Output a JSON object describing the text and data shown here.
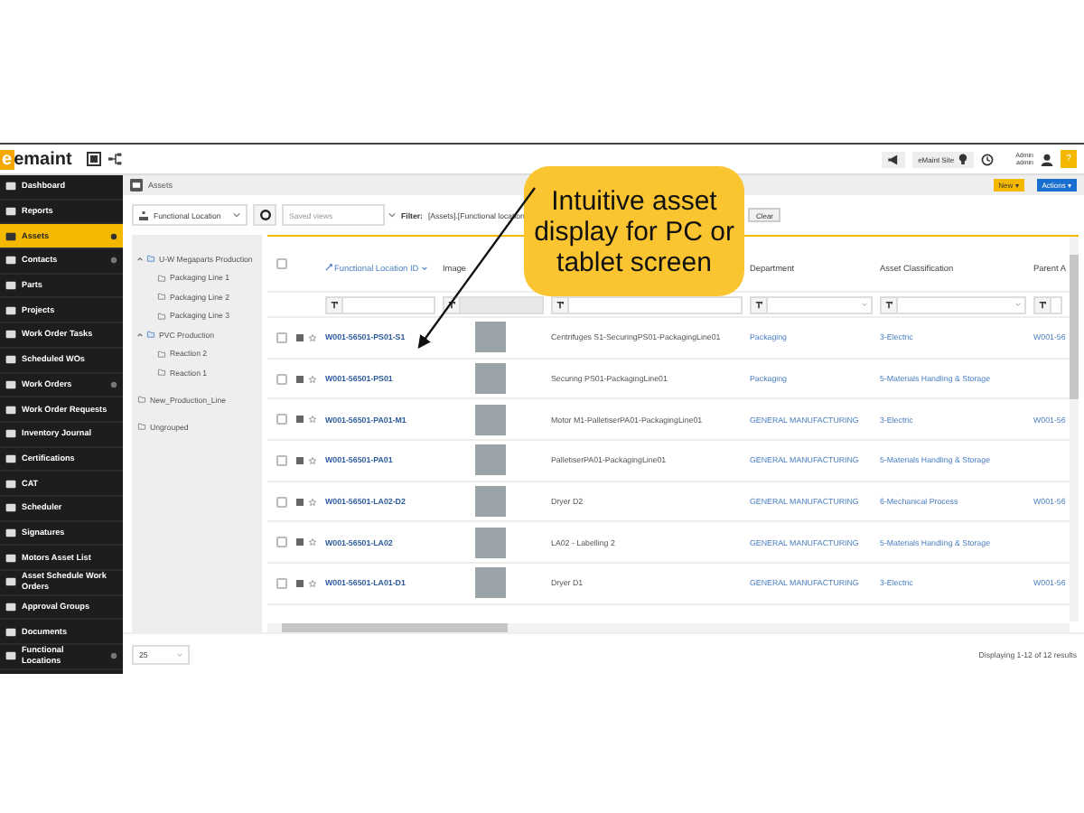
{
  "topbar": {
    "logo_letter": "e",
    "logo_text": "emaint",
    "site": "eMaint Site",
    "user_line1": "Admin",
    "user_line2": "admin",
    "help": "?"
  },
  "sidebar": {
    "items": [
      {
        "label": "Dashboard",
        "selected": false,
        "has_submenu": false
      },
      {
        "label": "Reports",
        "selected": false,
        "has_submenu": false
      },
      {
        "label": "Assets",
        "selected": true,
        "has_submenu": true
      },
      {
        "label": "Contacts",
        "selected": false,
        "has_submenu": true
      },
      {
        "label": "Parts",
        "selected": false,
        "has_submenu": false
      },
      {
        "label": "Projects",
        "selected": false,
        "has_submenu": false
      },
      {
        "label": "Work Order Tasks",
        "selected": false,
        "has_submenu": false
      },
      {
        "label": "Scheduled WOs",
        "selected": false,
        "has_submenu": false
      },
      {
        "label": "Work Orders",
        "selected": false,
        "has_submenu": true
      },
      {
        "label": "Work Order Requests",
        "selected": false,
        "has_submenu": false
      },
      {
        "label": "Inventory Journal",
        "selected": false,
        "has_submenu": false
      },
      {
        "label": "Certifications",
        "selected": false,
        "has_submenu": false
      },
      {
        "label": "CAT",
        "selected": false,
        "has_submenu": false
      },
      {
        "label": "Scheduler",
        "selected": false,
        "has_submenu": false
      },
      {
        "label": "Signatures",
        "selected": false,
        "has_submenu": false
      },
      {
        "label": "Motors Asset List",
        "selected": false,
        "has_submenu": false
      },
      {
        "label": "Asset Schedule Work Orders",
        "selected": false,
        "has_submenu": false
      },
      {
        "label": "Approval Groups",
        "selected": false,
        "has_submenu": false
      },
      {
        "label": "Documents",
        "selected": false,
        "has_submenu": false
      },
      {
        "label": "Functional Locations",
        "selected": false,
        "has_submenu": true
      }
    ]
  },
  "breadcrumb": {
    "title": "Assets",
    "buttons": [
      {
        "label": "New ▾",
        "kind": "new"
      },
      {
        "label": "Actions ▾",
        "kind": "actions"
      }
    ]
  },
  "toolbar": {
    "group_by": "Functional Location",
    "saved_views": {
      "placeholder": "Saved views"
    },
    "filter_label": "Filter:",
    "filter_text": "[Assets].[Functional location",
    "clear": "Clear"
  },
  "tree": [
    {
      "label": "U-W Megaparts Production",
      "expanded": true,
      "children": [
        {
          "label": "Packaging Line 1"
        },
        {
          "label": "Packaging Line 2"
        },
        {
          "label": "Packaging Line 3"
        }
      ]
    },
    {
      "label": "PVC Production",
      "expanded": true,
      "children": [
        {
          "label": "Reaction 2"
        },
        {
          "label": "Reaction 1"
        }
      ]
    },
    {
      "label": "New_Production_Line"
    },
    {
      "label": "Ungrouped"
    }
  ],
  "table": {
    "all_checked": false,
    "columns": [
      {
        "label": "Functional Location ID",
        "sortable": true
      },
      {
        "label": "Image",
        "sortable": false
      },
      {
        "label": "Department",
        "sortable": false
      },
      {
        "label": "Asset Classification",
        "sortable": false
      },
      {
        "label": "Parent A",
        "sortable": false
      }
    ],
    "rows": [
      {
        "checked": false,
        "id": "W001-56501-PS01-S1",
        "description": "Centrifuges S1-SecuringPS01-PackagingLine01",
        "department": "Packaging",
        "classification": "3-Electric",
        "parent": "W001-56"
      },
      {
        "checked": false,
        "id": "W001-56501-PS01",
        "description": "Securing PS01-PackagingLine01",
        "department": "Packaging",
        "classification": "5-Materials Handling & Storage",
        "parent": ""
      },
      {
        "checked": false,
        "id": "W001-56501-PA01-M1",
        "description": "Motor M1-PalletiserPA01-PackagingLine01",
        "department": "GENERAL MANUFACTURING",
        "classification": "3-Electric",
        "parent": "W001-56"
      },
      {
        "checked": false,
        "id": "W001-56501-PA01",
        "description": "PalletiserPA01-PackagingLine01",
        "department": "GENERAL MANUFACTURING",
        "classification": "5-Materials Handling & Storage",
        "parent": ""
      },
      {
        "checked": false,
        "id": "W001-56501-LA02-D2",
        "description": "Dryer D2",
        "department": "GENERAL MANUFACTURING",
        "classification": "6-Mechanical Process",
        "parent": "W001-56"
      },
      {
        "checked": false,
        "id": "W001-56501-LA02",
        "description": "LA02 - Labelling 2",
        "department": "GENERAL MANUFACTURING",
        "classification": "5-Materials Handling & Storage",
        "parent": ""
      },
      {
        "checked": false,
        "id": "W001-56501-LA01-D1",
        "description": "Dryer D1",
        "department": "GENERAL MANUFACTURING",
        "classification": "3-Electric",
        "parent": "W001-56"
      }
    ]
  },
  "footer": {
    "page_size": "25",
    "summary": "Displaying 1-12 of 12 results"
  },
  "callout": {
    "text": "Intuitive asset display for PC or tablet screen"
  }
}
